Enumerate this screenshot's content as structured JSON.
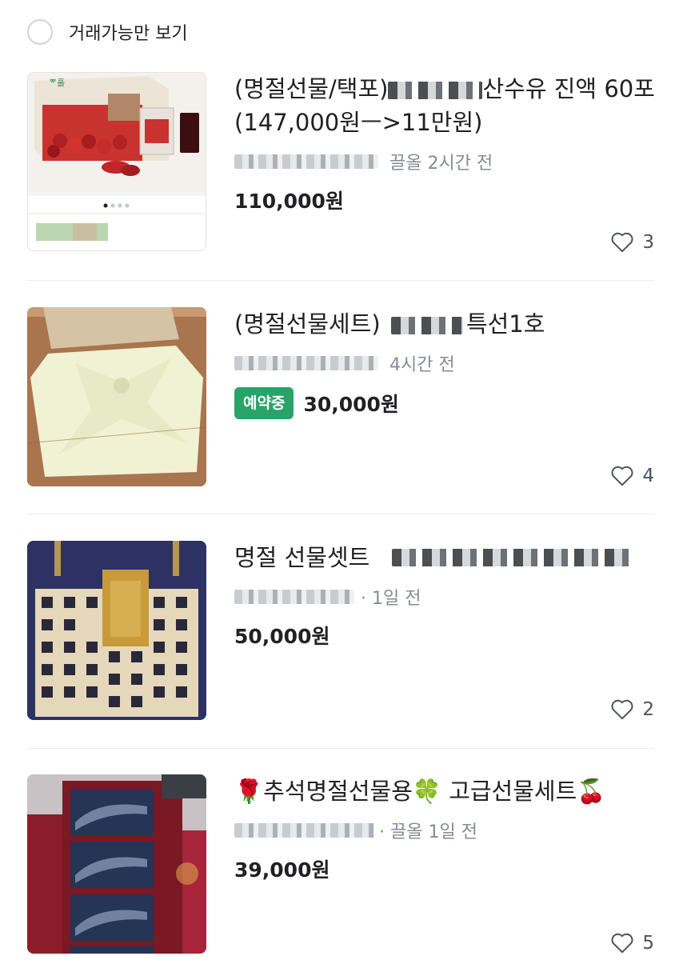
{
  "filter": {
    "label": "거래가능만 보기"
  },
  "items": [
    {
      "title_prefix": "(명절선물/택포)",
      "title_suffix": "산수유 진액 60포(147,000원ㅡ>11만원)",
      "meta": "끌올 2시간 전",
      "price": "110,000원",
      "likes": "3",
      "brand_text": "ᄬ홀"
    },
    {
      "title_prefix": "(명절선물세트)",
      "title_suffix": "특선1호",
      "meta": "4시간 전",
      "badge": "예약중",
      "price": "30,000원",
      "likes": "4"
    },
    {
      "title_prefix": "명절 선물셋트",
      "meta": "· 1일 전",
      "price": "50,000원",
      "likes": "2"
    },
    {
      "title_prefix": "🌹추석명절선물용🍀 고급선물세트🍒",
      "meta": "· 끌올 1일 전",
      "price": "39,000원",
      "likes": "5"
    }
  ],
  "colors": {
    "accent_green": "#2aa36b",
    "text": "#212124",
    "meta": "#868b94"
  },
  "icons": {
    "like": "heart-outline-icon",
    "filter": "radio-unchecked-icon"
  }
}
